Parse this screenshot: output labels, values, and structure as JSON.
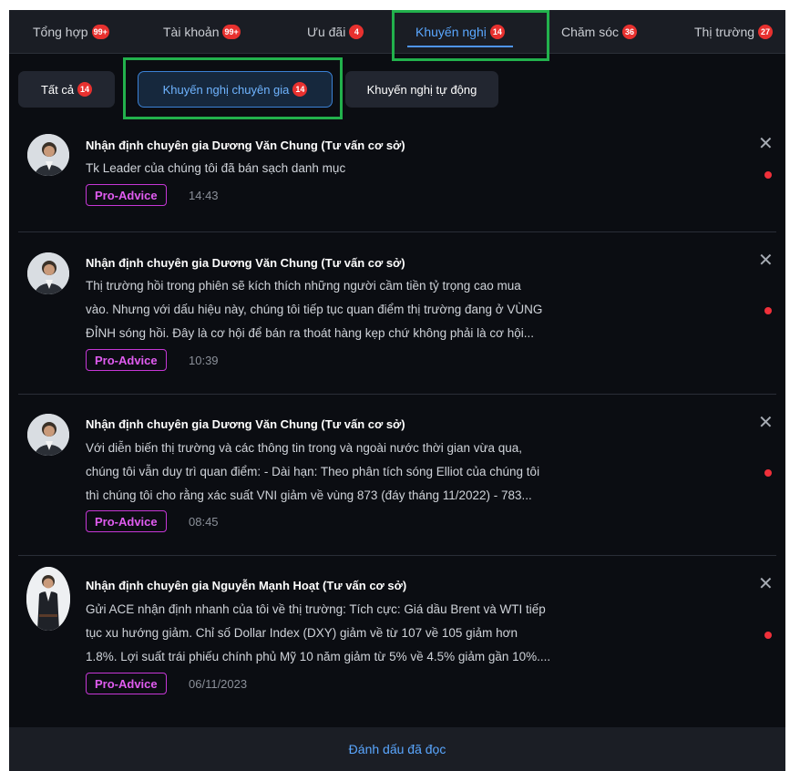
{
  "tabs": [
    {
      "label": "Tổng hợp",
      "badge": "99+"
    },
    {
      "label": "Tài khoản",
      "badge": "99+"
    },
    {
      "label": "Ưu đãi",
      "badge": "4"
    },
    {
      "label": "Khuyến nghị",
      "badge": "14"
    },
    {
      "label": "Chăm sóc",
      "badge": "36"
    },
    {
      "label": "Thị trường",
      "badge": "27"
    }
  ],
  "subtabs": [
    {
      "label": "Tất cả",
      "badge": "14"
    },
    {
      "label": "Khuyến nghị chuyên gia",
      "badge": "14"
    },
    {
      "label": "Khuyến nghị tự động"
    }
  ],
  "items": [
    {
      "title": "Nhận định chuyên gia Dương Văn Chung (Tư vấn cơ sở)",
      "lines": [
        "Tk Leader của chúng tôi đã bán sạch danh mục"
      ],
      "tag": "Pro-Advice",
      "time": "14:43",
      "close": "✕"
    },
    {
      "title": "Nhận định chuyên gia Dương Văn Chung (Tư vấn cơ sở)",
      "lines": [
        "Thị trường hồi trong phiên sẽ kích thích những người cầm tiền tỷ trọng cao mua",
        "vào. Nhưng với dấu hiệu này, chúng tôi tiếp tục quan điểm thị trường đang ở VÙNG",
        "ĐỈNH sóng hồi. Đây là cơ hội để bán ra thoát hàng kẹp chứ không phải là cơ hội..."
      ],
      "tag": "Pro-Advice",
      "time": "10:39",
      "close": "✕"
    },
    {
      "title": "Nhận định chuyên gia Dương Văn Chung (Tư vấn cơ sở)",
      "lines": [
        "Với diễn biến thị trường và các thông tin trong và ngoài nước thời gian vừa qua,",
        "chúng tôi vẫn duy trì quan điểm: - Dài hạn: Theo phân tích sóng Elliot của chúng tôi",
        "thì chúng tôi cho rằng xác suất VNI giảm về vùng 873 (đáy tháng 11/2022) - 783..."
      ],
      "tag": "Pro-Advice",
      "time": "08:45",
      "close": "✕"
    },
    {
      "title": "Nhận định chuyên gia Nguyễn Mạnh Hoạt (Tư vấn cơ sở)",
      "lines": [
        "Gửi ACE nhận định nhanh của tôi về thị trường: Tích cực: Giá dầu Brent và WTI tiếp",
        "tục xu hướng giảm. Chỉ số Dollar Index (DXY) giảm về từ 107 về 105 giảm hơn",
        "1.8%. Lợi suất trái phiếu chính phủ Mỹ 10 năm giảm từ 5% về 4.5% giảm gần 10%...."
      ],
      "tag": "Pro-Advice",
      "time": "06/11/2023",
      "close": "✕"
    }
  ],
  "footer": {
    "label": "Đánh dấu đã đọc"
  }
}
